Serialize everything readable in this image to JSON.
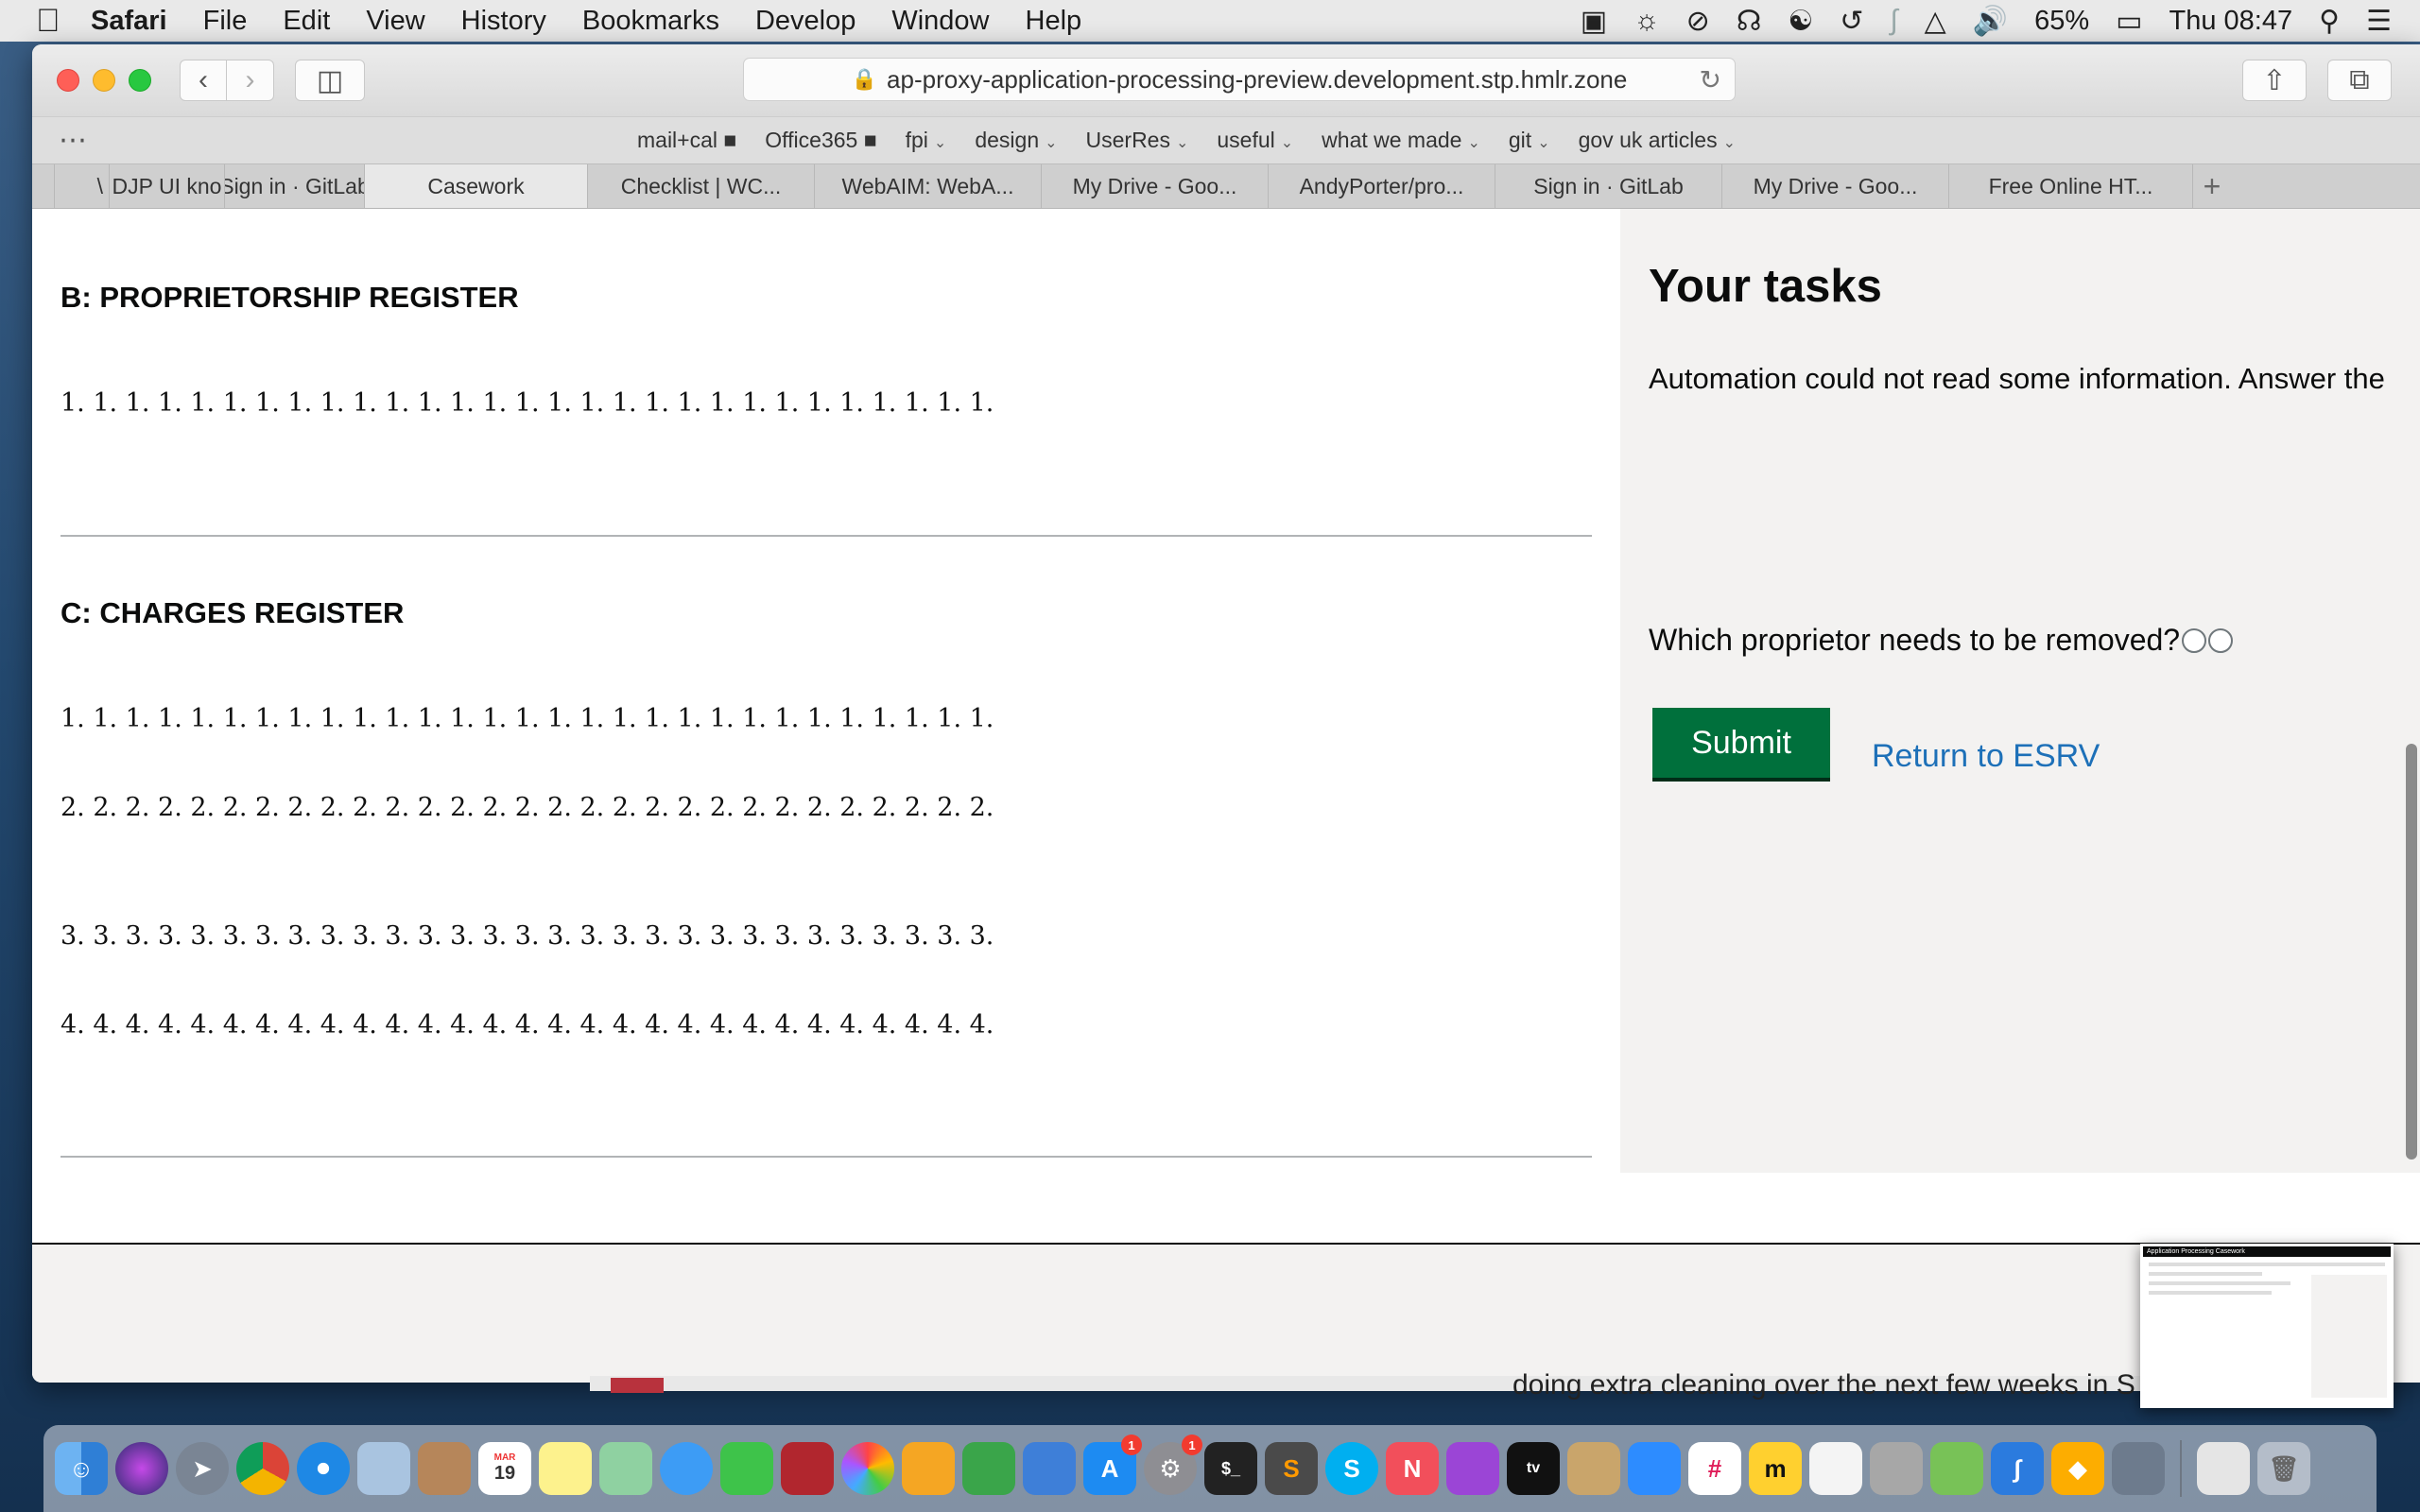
{
  "menubar": {
    "app_name": "Safari",
    "items": [
      "File",
      "Edit",
      "View",
      "History",
      "Bookmarks",
      "Develop",
      "Window",
      "Help"
    ],
    "battery": "65%",
    "clock": "Thu 08:47"
  },
  "browser": {
    "url": "ap-proxy-application-processing-preview.development.stp.hmlr.zone",
    "favorites": [
      "mail+cal ■",
      "Office365 ■",
      "fpi",
      "design",
      "UserRes",
      "useful",
      "what we made",
      "git",
      "gov uk articles"
    ],
    "tabs": [
      "",
      "\\",
      "DJP UI kno",
      "Sign in · GitLab",
      "Casework",
      "Checklist | WC...",
      "WebAIM: WebA...",
      "My Drive - Goo...",
      "AndyPorter/pro...",
      "Sign in · GitLab",
      "My Drive - Goo...",
      "Free Online HT...",
      "+"
    ]
  },
  "page": {
    "section_b": {
      "heading": "B: PROPRIETORSHIP REGISTER",
      "rows": [
        "1. 1. 1. 1. 1. 1. 1. 1. 1. 1. 1. 1. 1. 1. 1. 1. 1. 1. 1. 1. 1. 1. 1. 1. 1. 1. 1. 1. 1."
      ]
    },
    "section_c": {
      "heading": "C: CHARGES REGISTER",
      "rows": [
        "1. 1. 1. 1. 1. 1. 1. 1. 1. 1. 1. 1. 1. 1. 1. 1. 1. 1. 1. 1. 1. 1. 1. 1. 1. 1. 1. 1. 1.",
        "2. 2. 2. 2. 2. 2. 2. 2. 2. 2. 2. 2. 2. 2. 2. 2. 2. 2. 2. 2. 2. 2. 2. 2. 2. 2. 2. 2. 2.",
        "3. 3. 3. 3. 3. 3. 3. 3. 3. 3. 3. 3. 3. 3. 3. 3. 3. 3. 3. 3. 3. 3. 3. 3. 3. 3. 3. 3. 3.",
        "4. 4. 4. 4. 4. 4. 4. 4. 4. 4. 4. 4. 4. 4. 4. 4. 4. 4. 4. 4. 4. 4. 4. 4. 4. 4. 4. 4. 4."
      ]
    },
    "tasks": {
      "heading": "Your tasks",
      "hint": "Automation could not read some information. Answer the",
      "question": "Which proprietor needs to be removed?",
      "submit_label": "Submit",
      "return_label": "Return to ESRV"
    }
  },
  "background_window": {
    "text": "doing extra cleaning over the next few weeks in S"
  },
  "thumbnail": {
    "title": "Application Processing Casework"
  },
  "dock": {
    "icons": [
      "finder-icon",
      "siri-icon",
      "launchpad-icon",
      "chrome-icon",
      "safari-icon",
      "preview-icon",
      "contacts-icon",
      "calendar-icon",
      "notes-icon",
      "maps-icon",
      "messages-icon",
      "facetime-icon",
      "photo-booth-icon",
      "photos-icon",
      "pages-icon",
      "numbers-icon",
      "keynote-icon",
      "app-store-icon",
      "system-preferences-icon",
      "terminal-icon",
      "sublime-icon",
      "skype-icon",
      "news-icon",
      "podcasts-icon",
      "apple-tv-icon",
      "keychain-icon",
      "zoom-icon",
      "slack-icon",
      "miro-icon",
      "textedit-icon",
      "calculator-icon",
      "android-icon",
      "bluetooth-icon",
      "sketch-icon",
      "image-capture-icon",
      "printer-icon",
      "trash-icon"
    ],
    "calendar_month": "MAR",
    "calendar_day": "19",
    "app_store_badge": "1",
    "system_preferences_badge": "1"
  },
  "colors": {
    "govuk_green": "#00703c",
    "govuk_link": "#1d70b8",
    "aside_bg": "#f3f2f1"
  }
}
